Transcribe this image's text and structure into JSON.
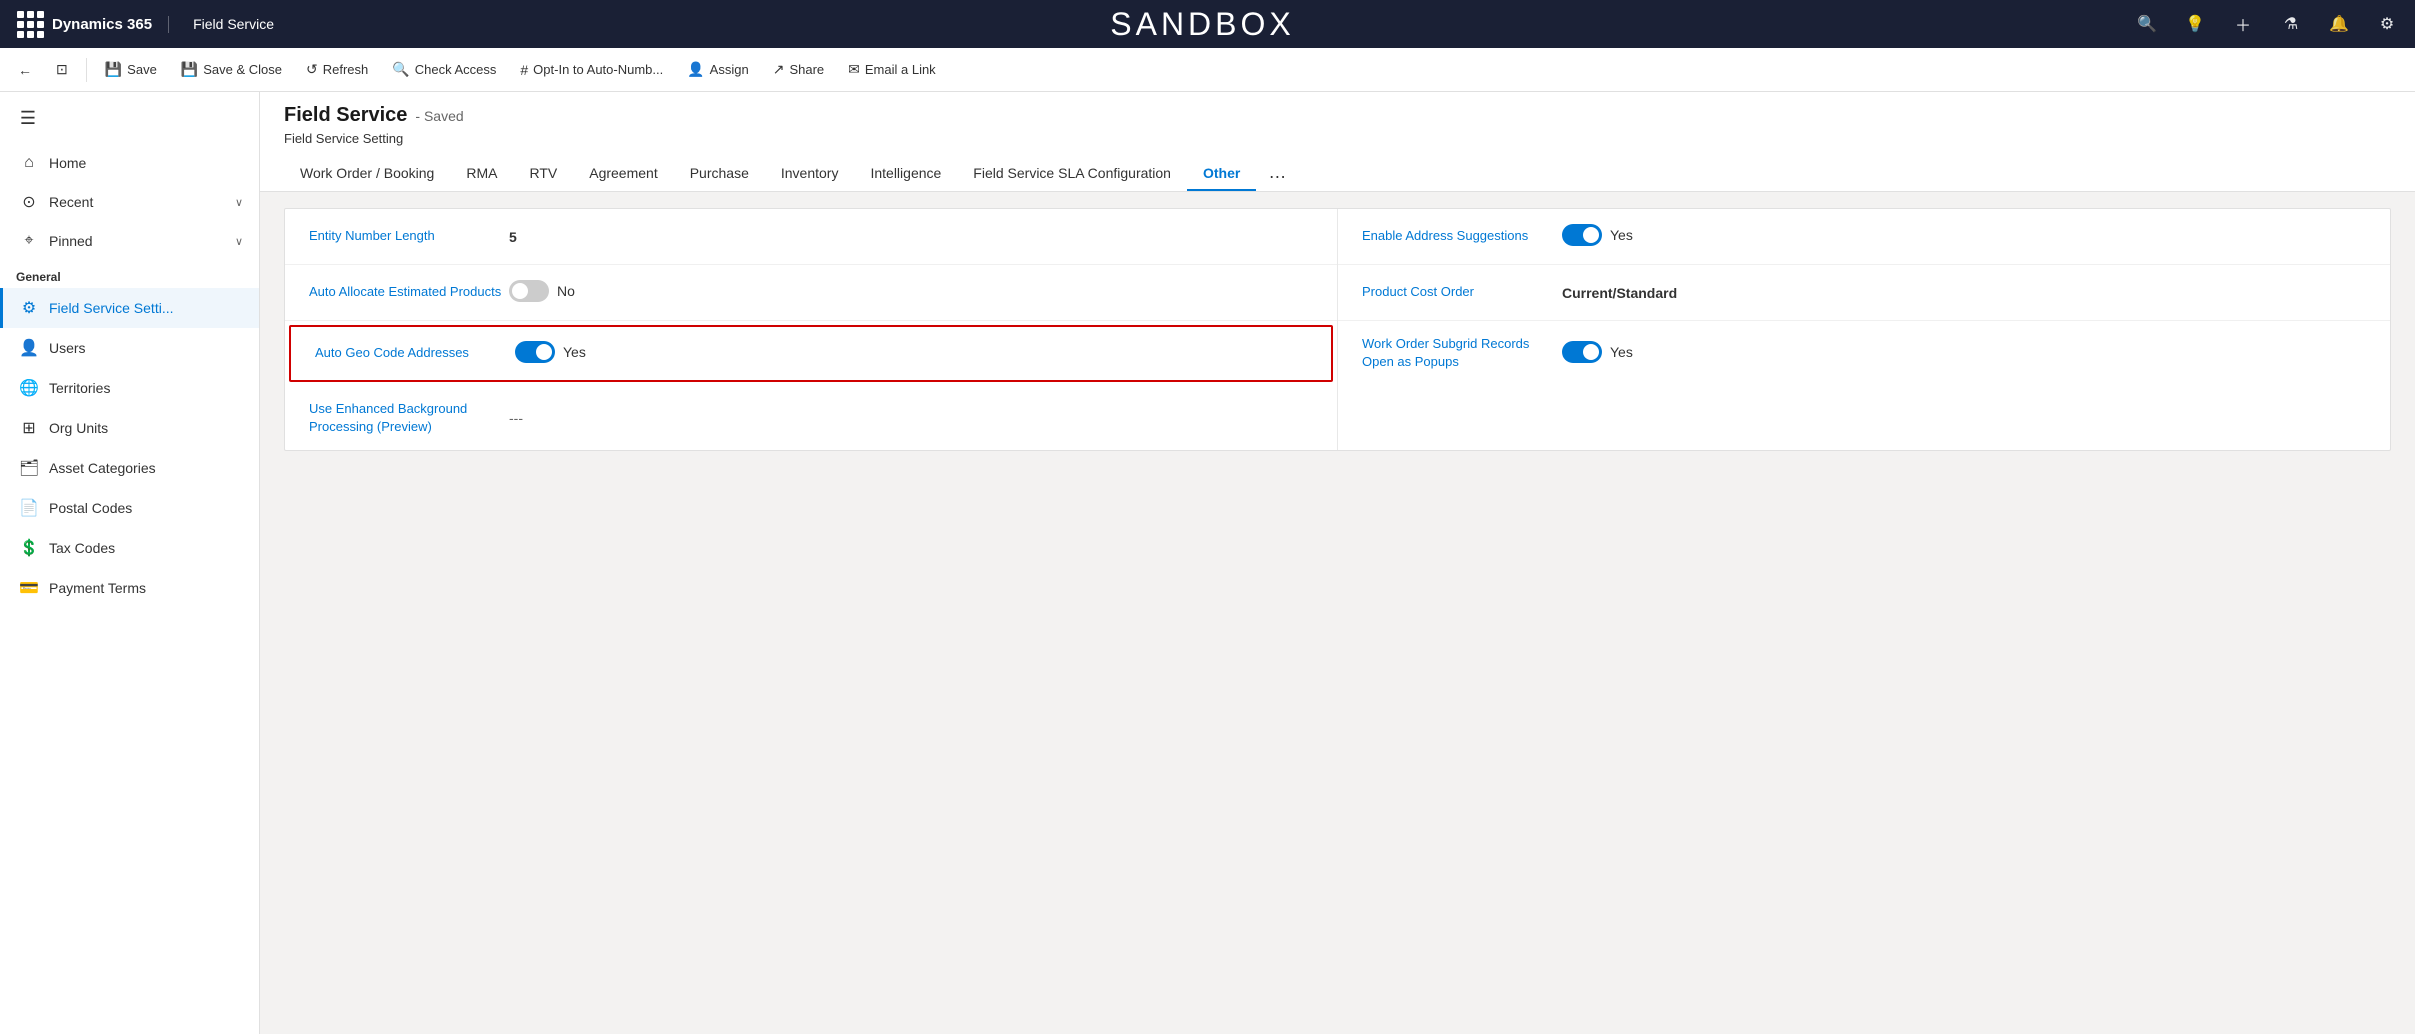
{
  "topnav": {
    "brand": "Dynamics 365",
    "app": "Field Service",
    "sandbox_title": "SANDBOX"
  },
  "commandbar": {
    "back_label": "←",
    "new_window_label": "⊡",
    "save_label": "Save",
    "save_close_label": "Save & Close",
    "refresh_label": "Refresh",
    "check_access_label": "Check Access",
    "opt_in_label": "Opt-In to Auto-Numb...",
    "assign_label": "Assign",
    "share_label": "Share",
    "email_link_label": "Email a Link"
  },
  "sidebar": {
    "menu_items": [
      {
        "id": "home",
        "label": "Home",
        "icon": "⌂"
      },
      {
        "id": "recent",
        "label": "Recent",
        "icon": "⊙",
        "chevron": "∨"
      },
      {
        "id": "pinned",
        "label": "Pinned",
        "icon": "⌖",
        "chevron": "∨"
      }
    ],
    "section_label": "General",
    "nav_items": [
      {
        "id": "field-service-settings",
        "label": "Field Service Setti...",
        "icon": "⚙",
        "active": true
      },
      {
        "id": "users",
        "label": "Users",
        "icon": "👤"
      },
      {
        "id": "territories",
        "label": "Territories",
        "icon": "🌐"
      },
      {
        "id": "org-units",
        "label": "Org Units",
        "icon": "⊞"
      },
      {
        "id": "asset-categories",
        "label": "Asset Categories",
        "icon": "🗂"
      },
      {
        "id": "postal-codes",
        "label": "Postal Codes",
        "icon": "📄"
      },
      {
        "id": "tax-codes",
        "label": "Tax Codes",
        "icon": "💲"
      },
      {
        "id": "payment-terms",
        "label": "Payment Terms",
        "icon": "💳"
      }
    ]
  },
  "page": {
    "title": "Field Service",
    "status": "- Saved",
    "subtitle": "Field Service Setting"
  },
  "tabs": [
    {
      "id": "work-order",
      "label": "Work Order / Booking",
      "active": false
    },
    {
      "id": "rma",
      "label": "RMA",
      "active": false
    },
    {
      "id": "rtv",
      "label": "RTV",
      "active": false
    },
    {
      "id": "agreement",
      "label": "Agreement",
      "active": false
    },
    {
      "id": "purchase",
      "label": "Purchase",
      "active": false
    },
    {
      "id": "inventory",
      "label": "Inventory",
      "active": false
    },
    {
      "id": "intelligence",
      "label": "Intelligence",
      "active": false
    },
    {
      "id": "sla-config",
      "label": "Field Service SLA Configuration",
      "active": false
    },
    {
      "id": "other",
      "label": "Other",
      "active": true
    }
  ],
  "form": {
    "left_col": [
      {
        "id": "entity-number-length",
        "label": "Entity Number Length",
        "value": "5",
        "type": "text",
        "bold": true
      },
      {
        "id": "auto-allocate",
        "label": "Auto Allocate Estimated Products",
        "value": "No",
        "type": "toggle",
        "toggle_on": false,
        "highlighted": false
      },
      {
        "id": "auto-geo-code",
        "label": "Auto Geo Code Addresses",
        "value": "Yes",
        "type": "toggle",
        "toggle_on": true,
        "highlighted": true
      },
      {
        "id": "use-enhanced-bg",
        "label": "Use Enhanced Background Processing (Preview)",
        "value": "---",
        "type": "text",
        "dash": true
      }
    ],
    "right_col": [
      {
        "id": "enable-address-suggestions",
        "label": "Enable Address Suggestions",
        "value": "Yes",
        "type": "toggle",
        "toggle_on": true
      },
      {
        "id": "product-cost-order",
        "label": "Product Cost Order",
        "value": "Current/Standard",
        "type": "text",
        "bold": true
      },
      {
        "id": "work-order-subgrid",
        "label": "Work Order Subgrid Records Open as Popups",
        "value": "Yes",
        "type": "toggle",
        "toggle_on": true
      }
    ]
  }
}
